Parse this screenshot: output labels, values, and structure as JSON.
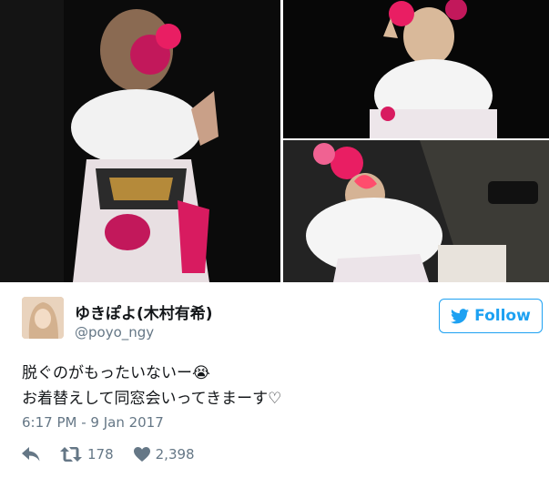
{
  "author": {
    "display_name": "ゆきぽよ(木村有希)",
    "handle": "@poyo_ngy"
  },
  "follow_button": {
    "label": "Follow",
    "icon": "twitter-bird-icon"
  },
  "tweet": {
    "line1": "脱ぐのがもったいないー😭",
    "line2": "お着替えして同窓会いってきまーす♡",
    "timestamp": "6:17 PM - 9 Jan 2017"
  },
  "actions": {
    "reply_icon": "reply-icon",
    "retweet_icon": "retweet-icon",
    "retweet_count": "178",
    "like_icon": "heart-icon",
    "like_count": "2,398"
  },
  "colors": {
    "accent": "#1da1f2",
    "muted": "#657786",
    "text": "#14171a"
  }
}
